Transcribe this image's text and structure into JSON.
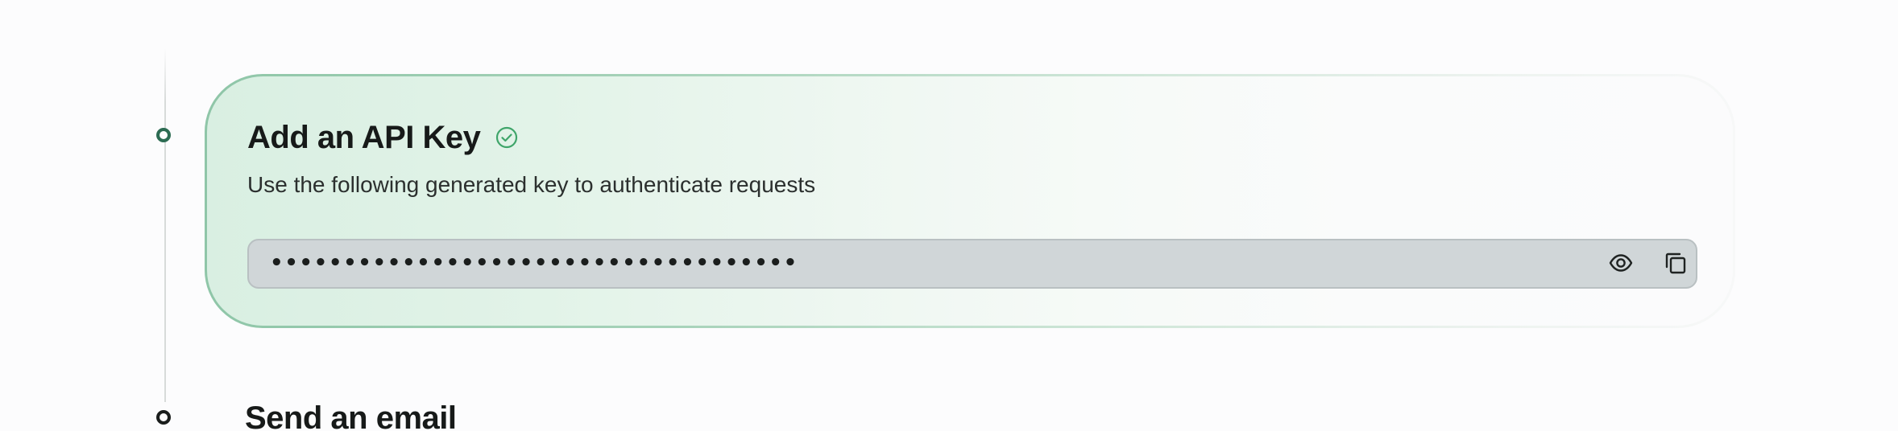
{
  "steps": [
    {
      "title": "Add an API Key",
      "completed": true,
      "subtitle": "Use the following generated key to authenticate requests",
      "api_key_masked": "••••••••••••••••••••••••••••••••••••",
      "icons": {
        "status": "check-circle-icon",
        "reveal": "eye-icon",
        "copy": "copy-icon"
      }
    },
    {
      "title": "Send an email",
      "completed": false
    }
  ],
  "colors": {
    "accent": "#2c6b52",
    "check": "#3fa56a",
    "card_gradient_start": "#d9efe2",
    "field_background": "#d0d6d8"
  }
}
